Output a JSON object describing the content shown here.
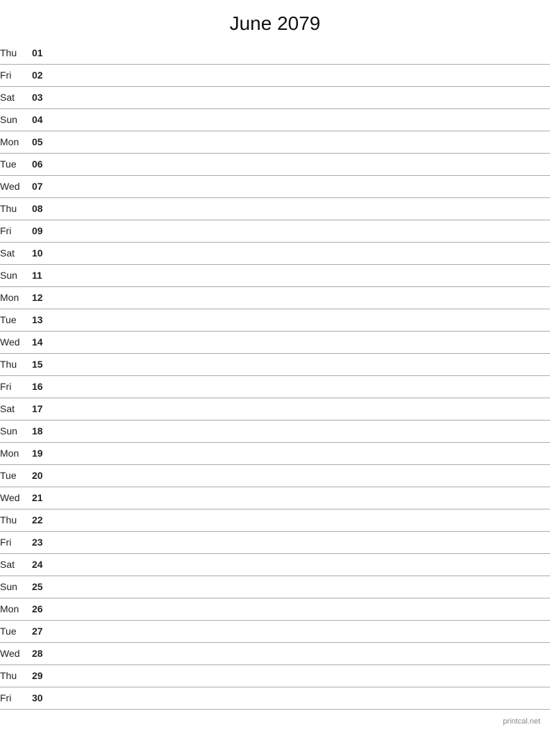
{
  "title": "June 2079",
  "footer": "printcal.net",
  "days": [
    {
      "dow": "Thu",
      "date": "01"
    },
    {
      "dow": "Fri",
      "date": "02"
    },
    {
      "dow": "Sat",
      "date": "03"
    },
    {
      "dow": "Sun",
      "date": "04"
    },
    {
      "dow": "Mon",
      "date": "05"
    },
    {
      "dow": "Tue",
      "date": "06"
    },
    {
      "dow": "Wed",
      "date": "07"
    },
    {
      "dow": "Thu",
      "date": "08"
    },
    {
      "dow": "Fri",
      "date": "09"
    },
    {
      "dow": "Sat",
      "date": "10"
    },
    {
      "dow": "Sun",
      "date": "11"
    },
    {
      "dow": "Mon",
      "date": "12"
    },
    {
      "dow": "Tue",
      "date": "13"
    },
    {
      "dow": "Wed",
      "date": "14"
    },
    {
      "dow": "Thu",
      "date": "15"
    },
    {
      "dow": "Fri",
      "date": "16"
    },
    {
      "dow": "Sat",
      "date": "17"
    },
    {
      "dow": "Sun",
      "date": "18"
    },
    {
      "dow": "Mon",
      "date": "19"
    },
    {
      "dow": "Tue",
      "date": "20"
    },
    {
      "dow": "Wed",
      "date": "21"
    },
    {
      "dow": "Thu",
      "date": "22"
    },
    {
      "dow": "Fri",
      "date": "23"
    },
    {
      "dow": "Sat",
      "date": "24"
    },
    {
      "dow": "Sun",
      "date": "25"
    },
    {
      "dow": "Mon",
      "date": "26"
    },
    {
      "dow": "Tue",
      "date": "27"
    },
    {
      "dow": "Wed",
      "date": "28"
    },
    {
      "dow": "Thu",
      "date": "29"
    },
    {
      "dow": "Fri",
      "date": "30"
    }
  ]
}
